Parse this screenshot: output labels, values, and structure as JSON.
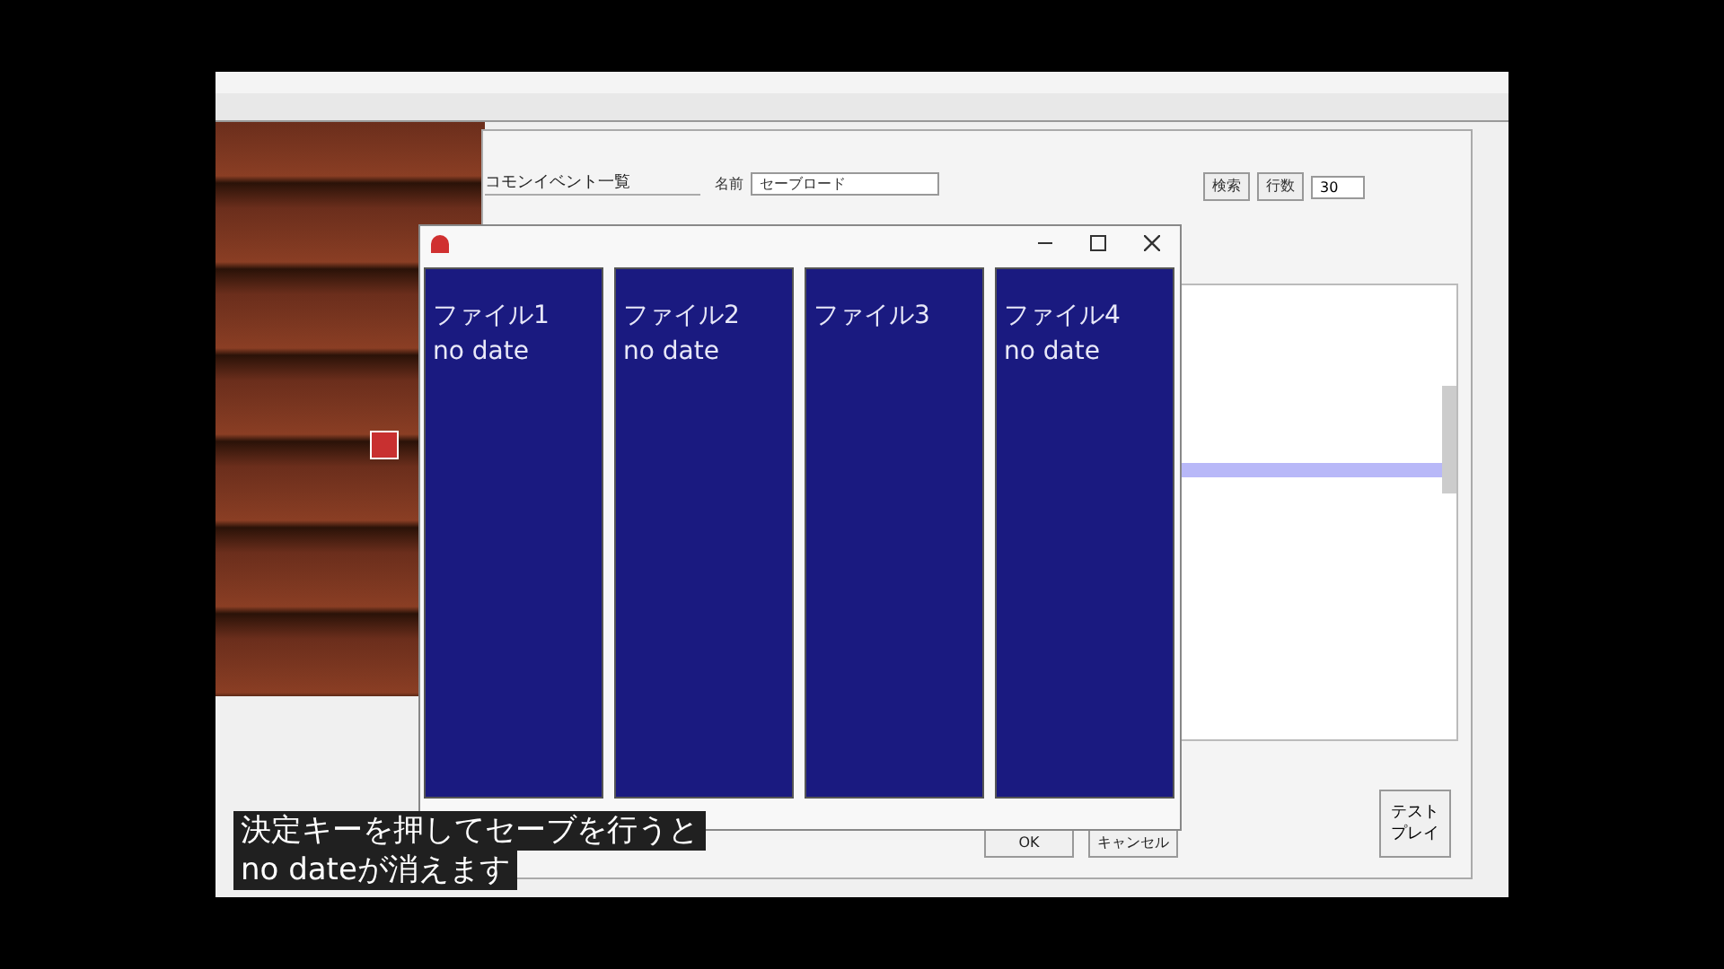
{
  "common_event_list": {
    "title": "コモンイベント一覧"
  },
  "event_name": {
    "label": "名前",
    "value": "セーブロード"
  },
  "editor_buttons": [
    {
      "label": "検索"
    },
    {
      "label": "行数"
    }
  ],
  "line_count": {
    "value": "30"
  },
  "game_window": {
    "slots": [
      {
        "label": "ファイル1",
        "date": "no date"
      },
      {
        "label": "ファイル2",
        "date": "no date"
      },
      {
        "label": "ファイル3"
      },
      {
        "label": "ファイル4",
        "date": "no date"
      }
    ]
  },
  "dialog_buttons": [
    {
      "label": "OK",
      "disabled": false
    },
    {
      "label": "キャンセル",
      "disabled": false
    }
  ],
  "test_play": [
    "テスト",
    "プレイ"
  ],
  "subtitle": [
    "決定キーを押してセーブを行うと",
    "no dateが消えます"
  ]
}
